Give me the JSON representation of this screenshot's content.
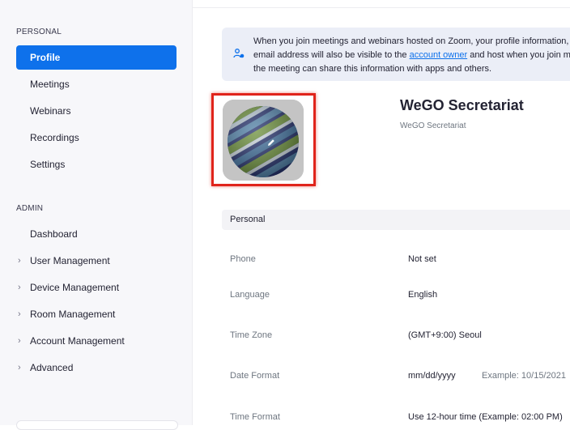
{
  "sidebar": {
    "personal_label": "PERSONAL",
    "personal_items": [
      {
        "label": "Profile",
        "active": true
      },
      {
        "label": "Meetings"
      },
      {
        "label": "Webinars"
      },
      {
        "label": "Recordings"
      },
      {
        "label": "Settings"
      }
    ],
    "admin_label": "ADMIN",
    "admin_items": [
      {
        "label": "Dashboard",
        "expandable": false
      },
      {
        "label": "User Management",
        "expandable": true
      },
      {
        "label": "Device Management",
        "expandable": true
      },
      {
        "label": "Room Management",
        "expandable": true
      },
      {
        "label": "Account Management",
        "expandable": true
      },
      {
        "label": "Advanced",
        "expandable": true
      }
    ],
    "chevron": "›"
  },
  "notice": {
    "line1": "When you join meetings and webinars hosted on Zoom, your profile information,",
    "line2_before": "email address will also be visible to the ",
    "line2_link": "account owner",
    "line2_after": " and host when you join me",
    "line3": "the meeting can share this information with apps and others.",
    "icon": "person-shield-icon"
  },
  "profile": {
    "name": "WeGO Secretariat",
    "subtitle": "WeGO Secretariat",
    "avatar_icon": "globe-logo",
    "edit_icon": "pencil-icon"
  },
  "personal_section": {
    "title": "Personal",
    "rows": [
      {
        "label": "Phone",
        "value": "Not set"
      },
      {
        "label": "Language",
        "value": "English"
      },
      {
        "label": "Time Zone",
        "value": "(GMT+9:00) Seoul"
      },
      {
        "label": "Date Format",
        "value": "mm/dd/yyyy",
        "extra": "Example: 10/15/2021"
      },
      {
        "label": "Time Format",
        "value": "Use 12-hour time (Example: 02:00 PM)"
      }
    ]
  },
  "colors": {
    "accent": "#0e71eb",
    "highlight_box": "#e0241b",
    "sidebar_bg": "#f7f7fa",
    "notice_bg": "#ebeef7"
  }
}
